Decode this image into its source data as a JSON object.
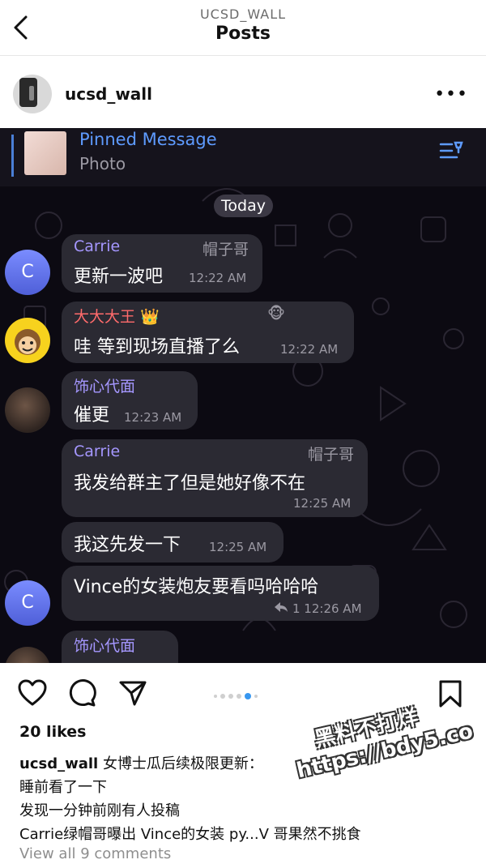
{
  "header": {
    "account": "UCSD_WALL",
    "title": "Posts"
  },
  "profile": {
    "username": "ucsd_wall",
    "more": "•••"
  },
  "media": {
    "pinned": {
      "title": "Pinned Message",
      "subtitle": "Photo"
    },
    "date_separator": "Today",
    "messages": [
      {
        "sender": "Carrie",
        "sender_color": "#a597ff",
        "tag": "帽子哥",
        "text": "更新一波吧",
        "time": "12:22 AM"
      },
      {
        "sender": "大大大王 👑",
        "sender_color": "#ff6b6b",
        "tag": "🐵",
        "text": "哇 等到现场直播了么",
        "time": "12:22 AM"
      },
      {
        "sender": "饰心代面",
        "sender_color": "#a597ff",
        "text": "催更",
        "time": "12:23 AM"
      },
      {
        "sender": "Carrie",
        "sender_color": "#a597ff",
        "tag": "帽子哥",
        "text": "我发给群主了但是她好像不在",
        "time": "12:25 AM"
      },
      {
        "text": "我这先发一下",
        "time": "12:25 AM"
      },
      {
        "text": "Vince的女装炮友要看吗哈哈哈",
        "time": "1 12:26 AM"
      },
      {
        "sender": "饰心代面",
        "sender_color": "#a597ff"
      }
    ],
    "avatar_letter": "C"
  },
  "actions": {
    "like": "heart-icon",
    "comment": "comment-icon",
    "share": "share-icon",
    "save": "bookmark-icon",
    "carousel_active_index": 3,
    "carousel_count": 6
  },
  "post": {
    "likes": "20 likes",
    "caption_user": "ucsd_wall",
    "caption_lines": [
      "女博士瓜后续极限更新：",
      "睡前看了一下",
      "发现一分钟前刚有人投稿",
      "Carrie绿帽哥曝出 Vince的女装 py...V 哥果然不挑食"
    ],
    "view_comments": "View all 9 comments"
  },
  "watermark": {
    "line1": "黑料不打烊",
    "line2": "https://bdy5.co"
  }
}
